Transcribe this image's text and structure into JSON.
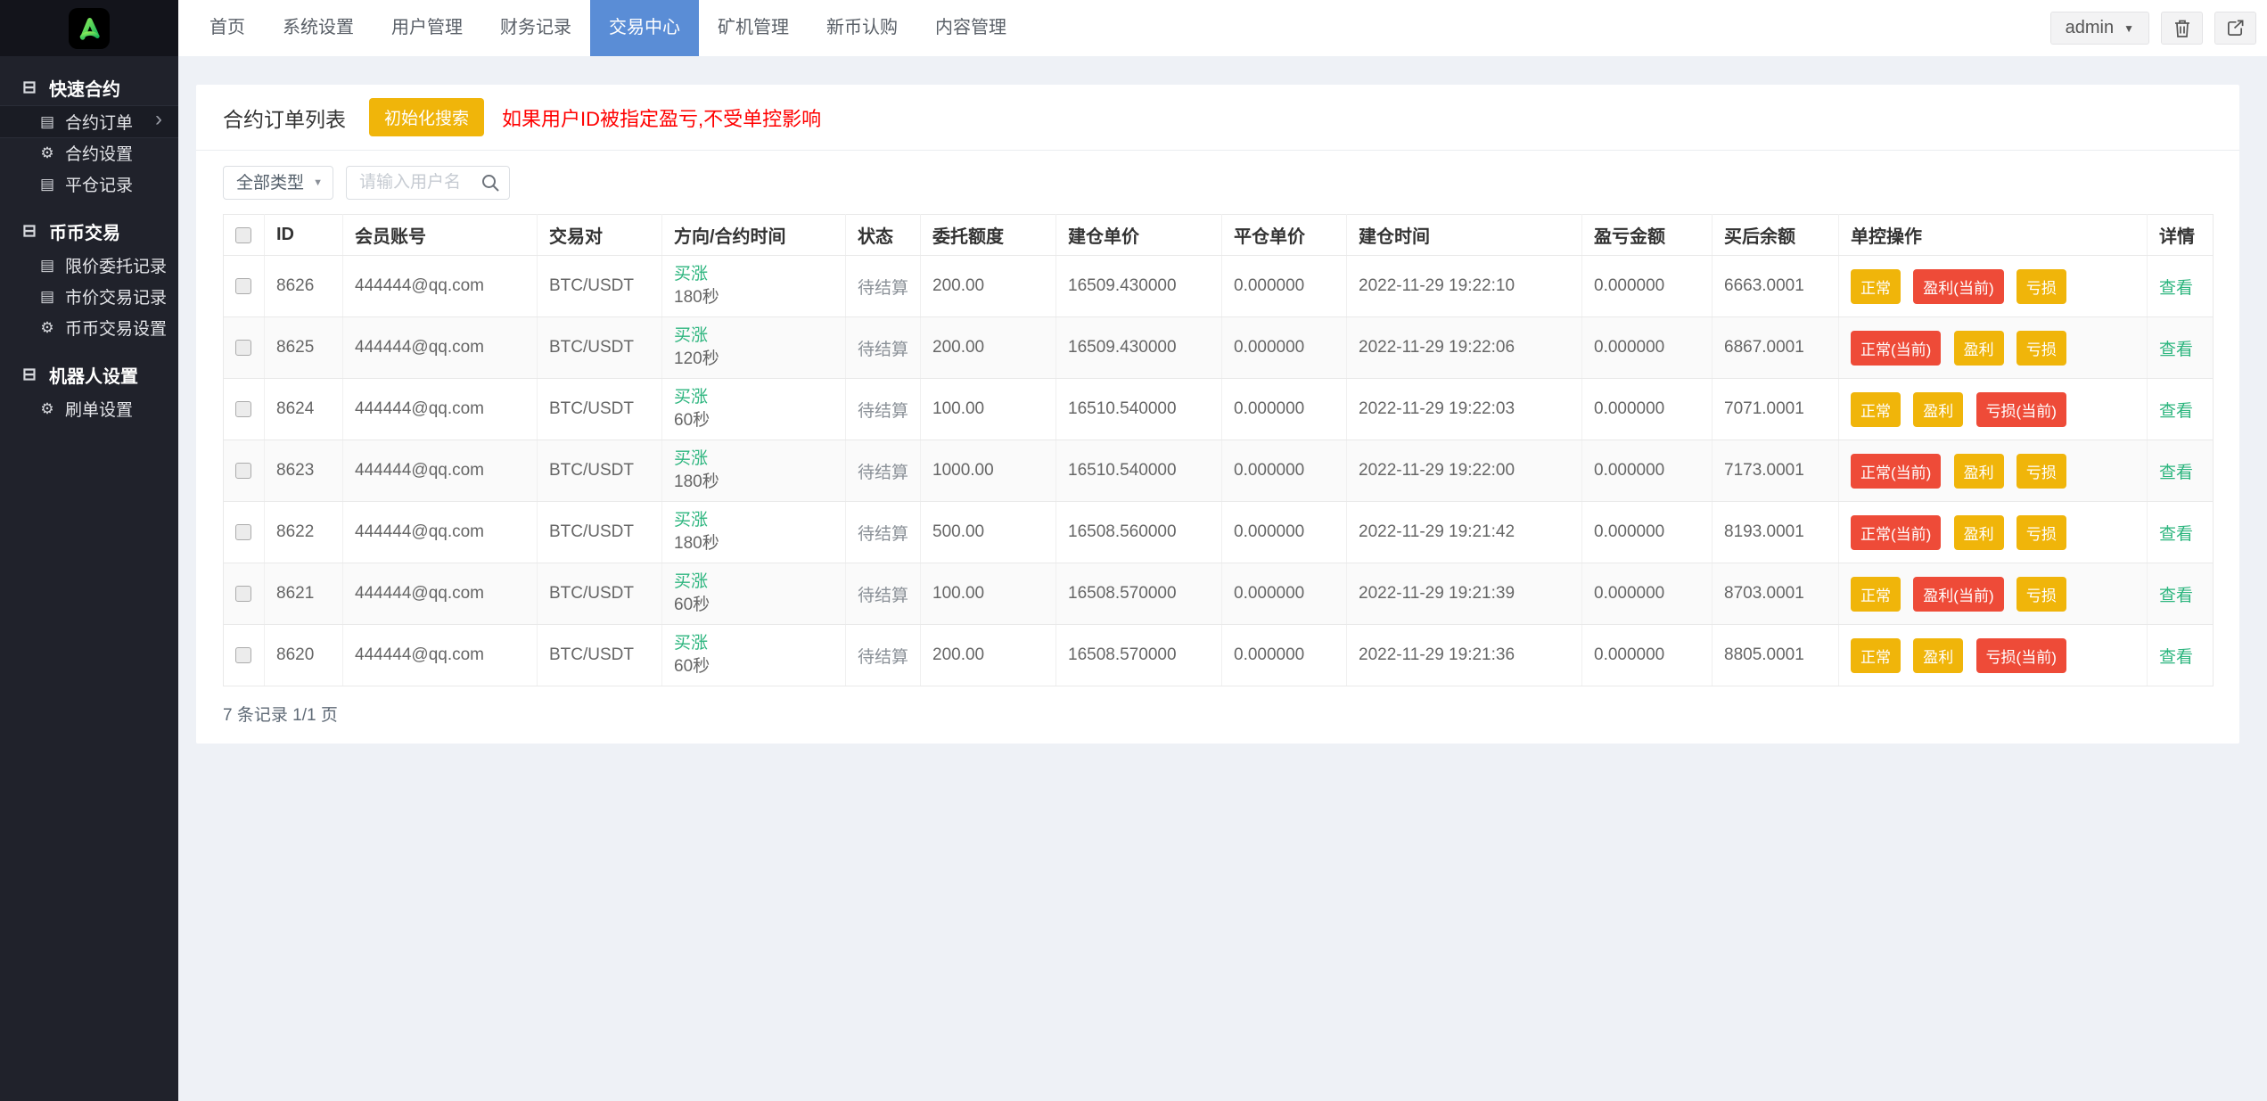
{
  "brand": {
    "logo_icon": "a-logo-icon"
  },
  "topnav": {
    "items": [
      {
        "label": "首页",
        "active": false
      },
      {
        "label": "系统设置",
        "active": false
      },
      {
        "label": "用户管理",
        "active": false
      },
      {
        "label": "财务记录",
        "active": false
      },
      {
        "label": "交易中心",
        "active": true
      },
      {
        "label": "矿机管理",
        "active": false
      },
      {
        "label": "新币认购",
        "active": false
      },
      {
        "label": "内容管理",
        "active": false
      }
    ],
    "user_menu": {
      "label": "admin",
      "caret_icon": "caret-down-icon",
      "caret_glyph": "▼"
    },
    "trash_icon": "trash-icon",
    "logout_icon": "logout-icon"
  },
  "sidebar": {
    "sections": [
      {
        "label": "快速合约",
        "icon": "collapse-minus-icon",
        "items": [
          {
            "label": "合约订单",
            "icon": "list-icon",
            "active": true
          },
          {
            "label": "合约设置",
            "icon": "gear-icon",
            "active": false
          },
          {
            "label": "平仓记录",
            "icon": "list-icon",
            "active": false
          }
        ]
      },
      {
        "label": "币币交易",
        "icon": "collapse-minus-icon",
        "items": [
          {
            "label": "限价委托记录",
            "icon": "list-icon",
            "active": false
          },
          {
            "label": "市价交易记录",
            "icon": "list-icon",
            "active": false
          },
          {
            "label": "币币交易设置",
            "icon": "gear-icon",
            "active": false
          }
        ]
      },
      {
        "label": "机器人设置",
        "icon": "collapse-minus-icon",
        "items": [
          {
            "label": "刷单设置",
            "icon": "gear-icon",
            "active": false
          }
        ]
      }
    ]
  },
  "page": {
    "title": "合约订单列表",
    "init_search_button": "初始化搜索",
    "warning": "如果用户ID被指定盈亏,不受单控影响"
  },
  "filters": {
    "type_selected": "全部类型",
    "search_placeholder": "请输入用户名",
    "search_icon": "search-icon"
  },
  "table": {
    "columns": [
      "ID",
      "会员账号",
      "交易对",
      "方向/合约时间",
      "状态",
      "委托额度",
      "建仓单价",
      "平仓单价",
      "建仓时间",
      "盈亏金额",
      "买后余额",
      "单控操作",
      "详情"
    ],
    "rows": [
      {
        "id": "8626",
        "account": "444444@qq.com",
        "pair": "BTC/USDT",
        "direction": "买涨",
        "duration": "180秒",
        "status": "待结算",
        "amount": "200.00",
        "open_price": "16509.430000",
        "close_price": "0.000000",
        "open_time": "2022-11-29 19:22:10",
        "pnl": "0.000000",
        "balance_after": "6663.0001",
        "controls": [
          {
            "label": "正常",
            "style": "yellow"
          },
          {
            "label": "盈利(当前)",
            "style": "red"
          },
          {
            "label": "亏损",
            "style": "yellow"
          }
        ],
        "detail": "查看"
      },
      {
        "id": "8625",
        "account": "444444@qq.com",
        "pair": "BTC/USDT",
        "direction": "买涨",
        "duration": "120秒",
        "status": "待结算",
        "amount": "200.00",
        "open_price": "16509.430000",
        "close_price": "0.000000",
        "open_time": "2022-11-29 19:22:06",
        "pnl": "0.000000",
        "balance_after": "6867.0001",
        "controls": [
          {
            "label": "正常(当前)",
            "style": "red"
          },
          {
            "label": "盈利",
            "style": "yellow"
          },
          {
            "label": "亏损",
            "style": "yellow"
          }
        ],
        "detail": "查看"
      },
      {
        "id": "8624",
        "account": "444444@qq.com",
        "pair": "BTC/USDT",
        "direction": "买涨",
        "duration": "60秒",
        "status": "待结算",
        "amount": "100.00",
        "open_price": "16510.540000",
        "close_price": "0.000000",
        "open_time": "2022-11-29 19:22:03",
        "pnl": "0.000000",
        "balance_after": "7071.0001",
        "controls": [
          {
            "label": "正常",
            "style": "yellow"
          },
          {
            "label": "盈利",
            "style": "yellow"
          },
          {
            "label": "亏损(当前)",
            "style": "red"
          }
        ],
        "detail": "查看"
      },
      {
        "id": "8623",
        "account": "444444@qq.com",
        "pair": "BTC/USDT",
        "direction": "买涨",
        "duration": "180秒",
        "status": "待结算",
        "amount": "1000.00",
        "open_price": "16510.540000",
        "close_price": "0.000000",
        "open_time": "2022-11-29 19:22:00",
        "pnl": "0.000000",
        "balance_after": "7173.0001",
        "controls": [
          {
            "label": "正常(当前)",
            "style": "red"
          },
          {
            "label": "盈利",
            "style": "yellow"
          },
          {
            "label": "亏损",
            "style": "yellow"
          }
        ],
        "detail": "查看"
      },
      {
        "id": "8622",
        "account": "444444@qq.com",
        "pair": "BTC/USDT",
        "direction": "买涨",
        "duration": "180秒",
        "status": "待结算",
        "amount": "500.00",
        "open_price": "16508.560000",
        "close_price": "0.000000",
        "open_time": "2022-11-29 19:21:42",
        "pnl": "0.000000",
        "balance_after": "8193.0001",
        "controls": [
          {
            "label": "正常(当前)",
            "style": "red"
          },
          {
            "label": "盈利",
            "style": "yellow"
          },
          {
            "label": "亏损",
            "style": "yellow"
          }
        ],
        "detail": "查看"
      },
      {
        "id": "8621",
        "account": "444444@qq.com",
        "pair": "BTC/USDT",
        "direction": "买涨",
        "duration": "60秒",
        "status": "待结算",
        "amount": "100.00",
        "open_price": "16508.570000",
        "close_price": "0.000000",
        "open_time": "2022-11-29 19:21:39",
        "pnl": "0.000000",
        "balance_after": "8703.0001",
        "controls": [
          {
            "label": "正常",
            "style": "yellow"
          },
          {
            "label": "盈利(当前)",
            "style": "red"
          },
          {
            "label": "亏损",
            "style": "yellow"
          }
        ],
        "detail": "查看"
      },
      {
        "id": "8620",
        "account": "444444@qq.com",
        "pair": "BTC/USDT",
        "direction": "买涨",
        "duration": "60秒",
        "status": "待结算",
        "amount": "200.00",
        "open_price": "16508.570000",
        "close_price": "0.000000",
        "open_time": "2022-11-29 19:21:36",
        "pnl": "0.000000",
        "balance_after": "8805.0001",
        "controls": [
          {
            "label": "正常",
            "style": "yellow"
          },
          {
            "label": "盈利",
            "style": "yellow"
          },
          {
            "label": "亏损(当前)",
            "style": "red"
          }
        ],
        "detail": "查看"
      }
    ]
  },
  "pagination": {
    "summary": "7 条记录 1/1 页"
  },
  "colors": {
    "accent_yellow": "#f0b50a",
    "accent_red": "#ee4b38",
    "green": "#2cb57e",
    "active_tab_blue": "#5a8dd6",
    "warning_red": "#ff0000",
    "sidebar_bg": "#20222b"
  }
}
